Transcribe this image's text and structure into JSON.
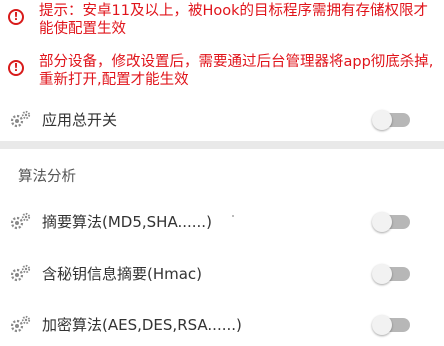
{
  "notices": [
    {
      "icon": "warning-circle-icon",
      "text": "提示：安卓11及以上，被Hook的目标程序需拥有存储权限才能使配置生效"
    },
    {
      "icon": "warning-circle-icon",
      "text": "部分设备，修改设置后，需要通过后台管理器将app彻底杀掉,重新打开,配置才能生效"
    }
  ],
  "main_switch": {
    "icon": "gears-icon",
    "label": "应用总开关",
    "enabled": false
  },
  "section": {
    "title": "算法分析"
  },
  "options": [
    {
      "icon": "gears-icon",
      "label": "摘要算法(MD5,SHA......)",
      "enabled": false
    },
    {
      "icon": "gears-icon",
      "label": "含秘钥信息摘要(Hmac)",
      "enabled": false
    },
    {
      "icon": "gears-icon",
      "label": "加密算法(AES,DES,RSA......)",
      "enabled": false
    }
  ],
  "colors": {
    "warning": "#e0141b",
    "toggle_off_track": "#b7b7b7",
    "divider": "#e9e9e9"
  }
}
